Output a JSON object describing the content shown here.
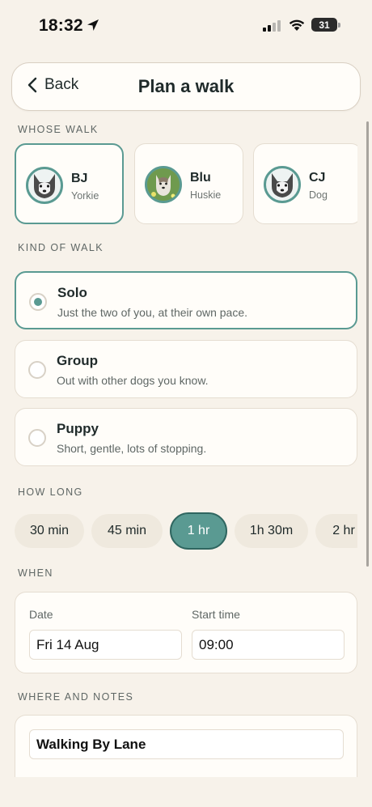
{
  "status_bar": {
    "time": "18:32",
    "battery": "31",
    "icons": [
      "location-arrow-icon",
      "cellular-signal-icon",
      "wifi-icon",
      "battery-icon"
    ]
  },
  "header": {
    "back_label": "Back",
    "title": "Plan a walk"
  },
  "whose_walk": {
    "label": "WHOSE WALK",
    "dogs": [
      {
        "name": "BJ",
        "breed": "Yorkie",
        "selected": true
      },
      {
        "name": "Blu",
        "breed": "Huskie",
        "selected": false
      },
      {
        "name": "CJ",
        "breed": "Dog",
        "selected": false
      }
    ]
  },
  "kind_of_walk": {
    "label": "KIND OF WALK",
    "options": [
      {
        "title": "Solo",
        "description": "Just the two of you, at their own pace.",
        "selected": true
      },
      {
        "title": "Group",
        "description": "Out with other dogs you know.",
        "selected": false
      },
      {
        "title": "Puppy",
        "description": "Short, gentle, lots of stopping.",
        "selected": false
      }
    ]
  },
  "how_long": {
    "label": "HOW LONG",
    "options": [
      "30 min",
      "45 min",
      "1 hr",
      "1h 30m",
      "2 hr"
    ],
    "selected": "1 hr"
  },
  "when": {
    "label": "WHEN",
    "date_label": "Date",
    "date_value": "Fri 14 Aug",
    "start_label": "Start time",
    "start_value": "09:00"
  },
  "where": {
    "label": "WHERE AND NOTES",
    "location_value": "Walking By Lane"
  },
  "colors": {
    "background": "#f7f2ea",
    "accent": "#5a9a92",
    "card": "#fffdf9",
    "chip": "#efe9de"
  }
}
